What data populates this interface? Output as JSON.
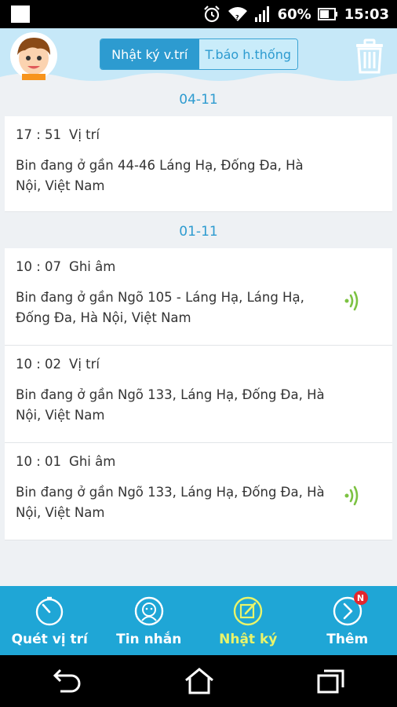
{
  "status_bar": {
    "battery_percent": "60%",
    "time": "15:03",
    "icons": [
      "notification-square-icon",
      "alarm-icon",
      "wifi-icon",
      "signal-icon",
      "battery-icon"
    ]
  },
  "header": {
    "tabs": [
      {
        "label": "Nhật ký v.trí",
        "active": true
      },
      {
        "label": "T.báo h.thống",
        "active": false
      }
    ],
    "icons": [
      "avatar",
      "trash-icon"
    ]
  },
  "log": [
    {
      "date": "04-11",
      "entries": [
        {
          "time": "17 : 51",
          "type": "Vị trí",
          "text": "Bin đang ở gần 44-46 Láng Hạ, Đống Đa, Hà Nội, Việt Nam",
          "has_audio": false
        }
      ]
    },
    {
      "date": "01-11",
      "entries": [
        {
          "time": "10 : 07",
          "type": "Ghi âm",
          "text": "Bin đang ở gần Ngõ 105 - Láng Hạ, Láng Hạ, Đống Đa, Hà Nội, Việt Nam",
          "has_audio": true
        },
        {
          "time": "10 : 02",
          "type": "Vị trí",
          "text": "Bin đang ở gần Ngõ 133, Láng Hạ, Đống Đa, Hà Nội, Việt Nam",
          "has_audio": false
        },
        {
          "time": "10 : 01",
          "type": "Ghi âm",
          "text": "Bin đang ở gần Ngõ 133, Láng Hạ, Đống Đa, Hà Nội, Việt Nam",
          "has_audio": true
        }
      ]
    }
  ],
  "bottom_nav": [
    {
      "label": "Quét vị trí",
      "icon": "stopwatch-icon",
      "active": false
    },
    {
      "label": "Tin nhắn",
      "icon": "message-face-icon",
      "active": false
    },
    {
      "label": "Nhật ký",
      "icon": "edit-note-icon",
      "active": true
    },
    {
      "label": "Thêm",
      "icon": "chevron-right-circle-icon",
      "active": false,
      "badge": "N"
    }
  ],
  "colors": {
    "accent": "#2d9bd0",
    "nav_bg": "#1fa6d6",
    "nav_active": "#e9f46a",
    "audio_green": "#7cc242",
    "badge_red": "#e3262d"
  }
}
